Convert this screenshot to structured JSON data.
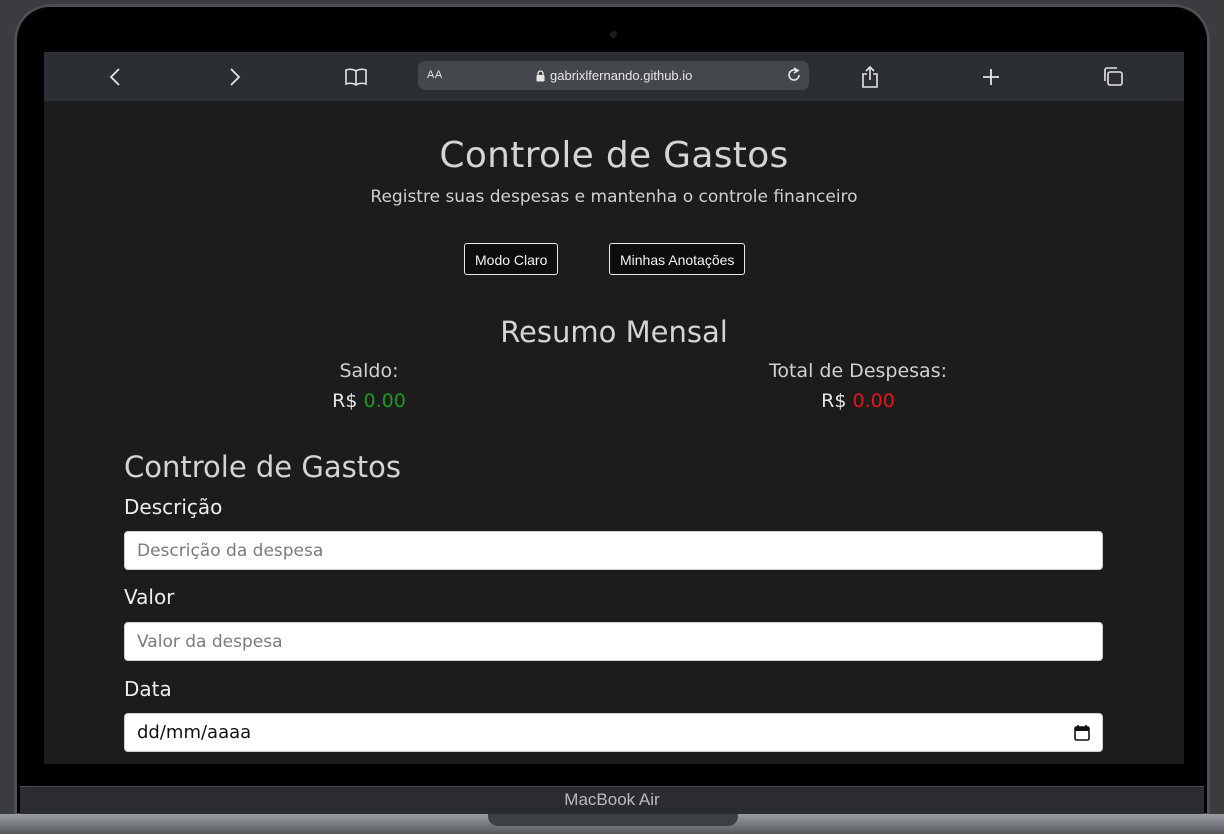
{
  "browser": {
    "url_aa": "AA",
    "url_host": "gabrixlfernando.github.io",
    "icons": [
      "back-icon",
      "forward-icon",
      "bookmarks-icon",
      "lock-icon",
      "reload-icon",
      "share-icon",
      "new-tab-icon",
      "tabs-icon"
    ]
  },
  "header": {
    "title": "Controle de Gastos",
    "subtitle": "Registre suas despesas e mantenha o controle financeiro",
    "buttons": {
      "mode": "Modo Claro",
      "notes": "Minhas Anotações"
    }
  },
  "summary": {
    "title": "Resumo Mensal",
    "balance_label": "Saldo:",
    "balance_currency": "R$",
    "balance_value": "0.00",
    "expenses_label": "Total de Despesas:",
    "expenses_currency": "R$",
    "expenses_value": "0.00",
    "colors": {
      "balance": "#1a9c1a",
      "expenses": "#e8141b"
    }
  },
  "form": {
    "title": "Controle de Gastos",
    "description": {
      "label": "Descrição",
      "placeholder": "Descrição da despesa",
      "value": ""
    },
    "amount": {
      "label": "Valor",
      "placeholder": "Valor da despesa",
      "value": ""
    },
    "date": {
      "label": "Data",
      "display": "dd/mm/aaaa"
    }
  },
  "device": {
    "label": "MacBook Air"
  }
}
